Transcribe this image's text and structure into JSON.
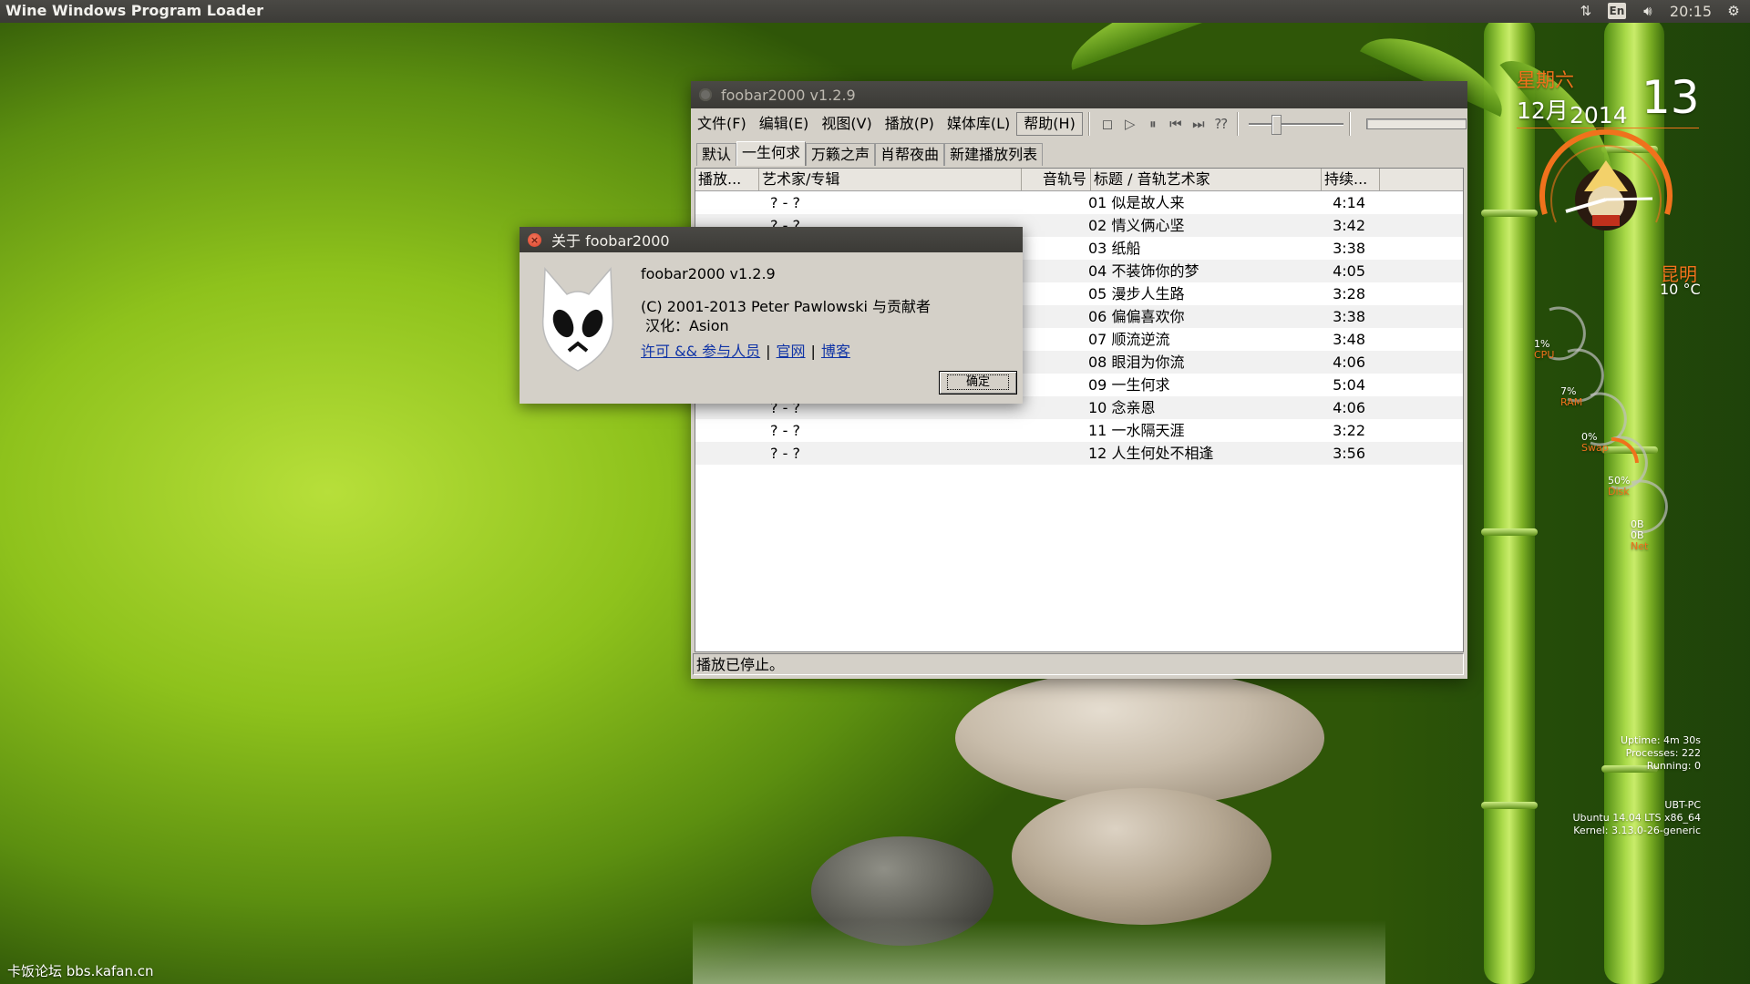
{
  "top_panel": {
    "app_title": "Wine Windows Program Loader",
    "keyboard": "En",
    "time": "20:15",
    "icons": [
      "network-arrows-icon",
      "keyboard-icon",
      "volume-icon",
      "settings-gear-icon"
    ]
  },
  "foobar": {
    "title": "foobar2000 v1.2.9",
    "menu": [
      "文件(F)",
      "编辑(E)",
      "视图(V)",
      "播放(P)",
      "媒体库(L)",
      "帮助(H)"
    ],
    "tabs": [
      "默认",
      "一生何求",
      "万籁之声",
      "肖帮夜曲",
      "新建播放列表"
    ],
    "active_tab": "一生何求",
    "columns": [
      "播放...",
      "艺术家/专辑",
      "音轨号",
      "标题 / 音轨艺术家",
      "持续..."
    ],
    "rows": [
      {
        "artist": "? - ?",
        "title": "01 似是故人来",
        "duration": "4:14"
      },
      {
        "artist": "? - ?",
        "title": "02 情义俩心坚",
        "duration": "3:42"
      },
      {
        "artist": "? - ?",
        "title": "03 纸船",
        "duration": "3:38"
      },
      {
        "artist": "? - ?",
        "title": "04 不装饰你的梦",
        "duration": "4:05"
      },
      {
        "artist": "? - ?",
        "title": "05 漫步人生路",
        "duration": "3:28"
      },
      {
        "artist": "? - ?",
        "title": "06 偏偏喜欢你",
        "duration": "3:38"
      },
      {
        "artist": "? - ?",
        "title": "07 顺流逆流",
        "duration": "3:48"
      },
      {
        "artist": "? - ?",
        "title": "08 眼泪为你流",
        "duration": "4:06"
      },
      {
        "artist": "? - ?",
        "title": "09 一生何求",
        "duration": "5:04"
      },
      {
        "artist": "? - ?",
        "title": "10 念亲恩",
        "duration": "4:06"
      },
      {
        "artist": "? - ?",
        "title": "11 一水隔天涯",
        "duration": "3:22"
      },
      {
        "artist": "? - ?",
        "title": "12 人生何处不相逢",
        "duration": "3:56"
      }
    ],
    "status": "播放已停止。",
    "seek_position": 0.27
  },
  "about": {
    "title": "关于 foobar2000",
    "version": "foobar2000 v1.2.9",
    "copyright": "(C) 2001-2013 Peter Pawlowski 与贡献者",
    "localization": "汉化：Asion",
    "links": [
      "许可 && 参与人员",
      "官网",
      "博客"
    ],
    "ok_label": "确定"
  },
  "conky": {
    "weekday": "星期六",
    "month": "12月",
    "year": "2014",
    "day": "13",
    "city": "昆明",
    "temperature": "10 °C",
    "cpu": {
      "value": "1%",
      "label": "CPU"
    },
    "ram": {
      "value": "7%",
      "label": "RAM"
    },
    "swap": {
      "value": "0%",
      "label": "Swap"
    },
    "disk": {
      "value": "50%",
      "label": "Disk"
    },
    "net": {
      "down": "0B",
      "up": "0B",
      "label": "Net"
    },
    "uptime": "Uptime: 4m 30s",
    "processes": "Processes: 222",
    "running": "Running: 0",
    "hostname": "UBT-PC",
    "os": "Ubuntu 14.04 LTS  x86_64",
    "kernel": "Kernel: 3.13.0-26-generic",
    "accent": "#f0721c"
  },
  "watermark": "卡饭论坛 bbs.kafan.cn"
}
